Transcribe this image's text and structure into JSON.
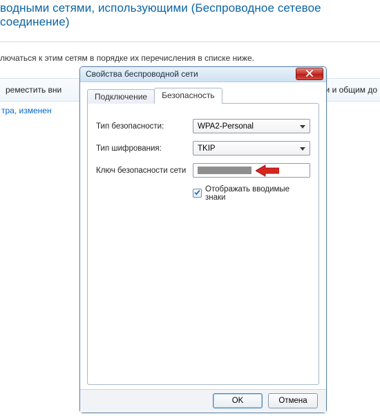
{
  "background": {
    "heading": "водными сетями, использующими (Беспроводное сетевое соединение)",
    "description": "лючаться к этим сетям в порядке их перечисления в списке ниже.",
    "toolbar_move_down": "реместить вни",
    "toolbar_shared": "и и общим до",
    "link_text": "тра, изменен"
  },
  "dialog": {
    "title": "Свойства беспроводной сети",
    "tabs": {
      "connection": "Подключение",
      "security": "Безопасность"
    },
    "fields": {
      "security_type_label": "Тип безопасности:",
      "security_type_value": "WPA2-Personal",
      "encryption_type_label": "Тип шифрования:",
      "encryption_type_value": "TKIP",
      "network_key_label": "Ключ безопасности сети",
      "network_key_value": ""
    },
    "checkbox": {
      "show_chars_label": "Отображать вводимые знаки",
      "show_chars_checked": true
    },
    "buttons": {
      "ok": "OK",
      "cancel": "Отмена"
    }
  }
}
